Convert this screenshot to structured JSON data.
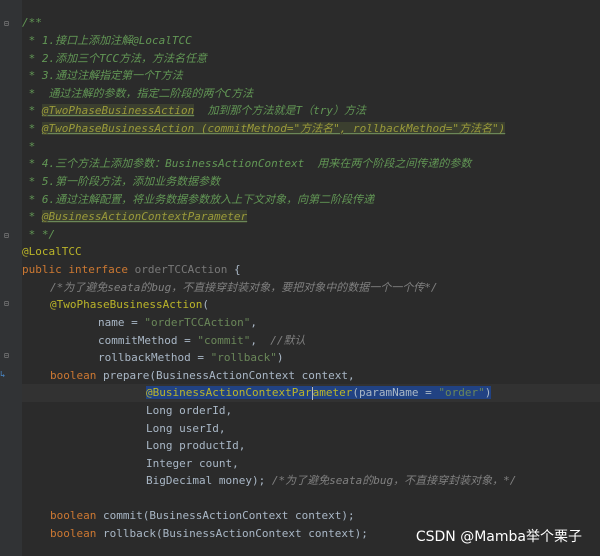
{
  "code": {
    "doc_open": "/**",
    "doc1": " * 1.接口上添加注解@LocalTCC",
    "doc2": " * 2.添加三个TCC方法，方法名任意",
    "doc3": " * 3.通过注解指定第一个T方法",
    "doc4": " *  通过注解的参数，指定二阶段的两个C方法",
    "doc5_prefix": " * ",
    "doc5_tag": "@TwoPhaseBusinessAction",
    "doc5_rest": "  加到那个方法就是T（try）方法",
    "doc6_prefix": " * ",
    "doc6_tag": "@TwoPhaseBusinessAction (commitMethod=\"方法名\", rollbackMethod=\"方法名\")",
    "doc7": " *",
    "doc8": " * 4.三个方法上添加参数：BusinessActionContext  用来在两个阶段之间传递的参数",
    "doc9": " * 5.第一阶段方法，添加业务数据参数",
    "doc10": " * 6.通过注解配置，将业务数据参数放入上下文对象，向第二阶段传递",
    "doc11_prefix": " * ",
    "doc11_tag": "@BusinessActionContextParameter",
    "doc_close": " * */",
    "anno_local": "@LocalTCC",
    "kw_public": "public",
    "kw_interface": "interface",
    "iface_name": "orderTCCAction",
    "brace_open": " {",
    "comment_bug": "/*为了避免seata的bug，不直接穿封装对象，要把对象中的数据一个一个传*/",
    "anno_tpba": "@TwoPhaseBusinessAction",
    "paren_open": "(",
    "name_key": "name",
    "eq": " = ",
    "name_val": "\"orderTCCAction\"",
    "comma": ",",
    "commit_key": "commitMethod",
    "commit_val": "\"commit\"",
    "comment_default": "//默认",
    "rollback_key": "rollbackMethod",
    "rollback_val": "\"rollback\"",
    "paren_close": ")",
    "kw_boolean": "boolean",
    "prepare_name": "prepare",
    "prepare_params": "(BusinessActionContext context,",
    "anno_bacp_a": "@BusinessActionContextPar",
    "anno_bacp_b": "ameter",
    "param_name_key": "(paramName = ",
    "param_name_val": "\"order\"",
    "param_close": ")",
    "p_order": "Long orderId,",
    "p_user": "Long userId,",
    "p_product": "Long productId,",
    "p_count": "Integer count,",
    "p_money": "BigDecimal money);",
    "comment_bug2": " /*为了避免seata的bug，不直接穿封装对象，*/",
    "commit_name": "commit",
    "rollback_name": "rollback",
    "ctx_param": "(BusinessActionContext context);"
  },
  "watermark": "CSDN @Mamba举个栗子"
}
